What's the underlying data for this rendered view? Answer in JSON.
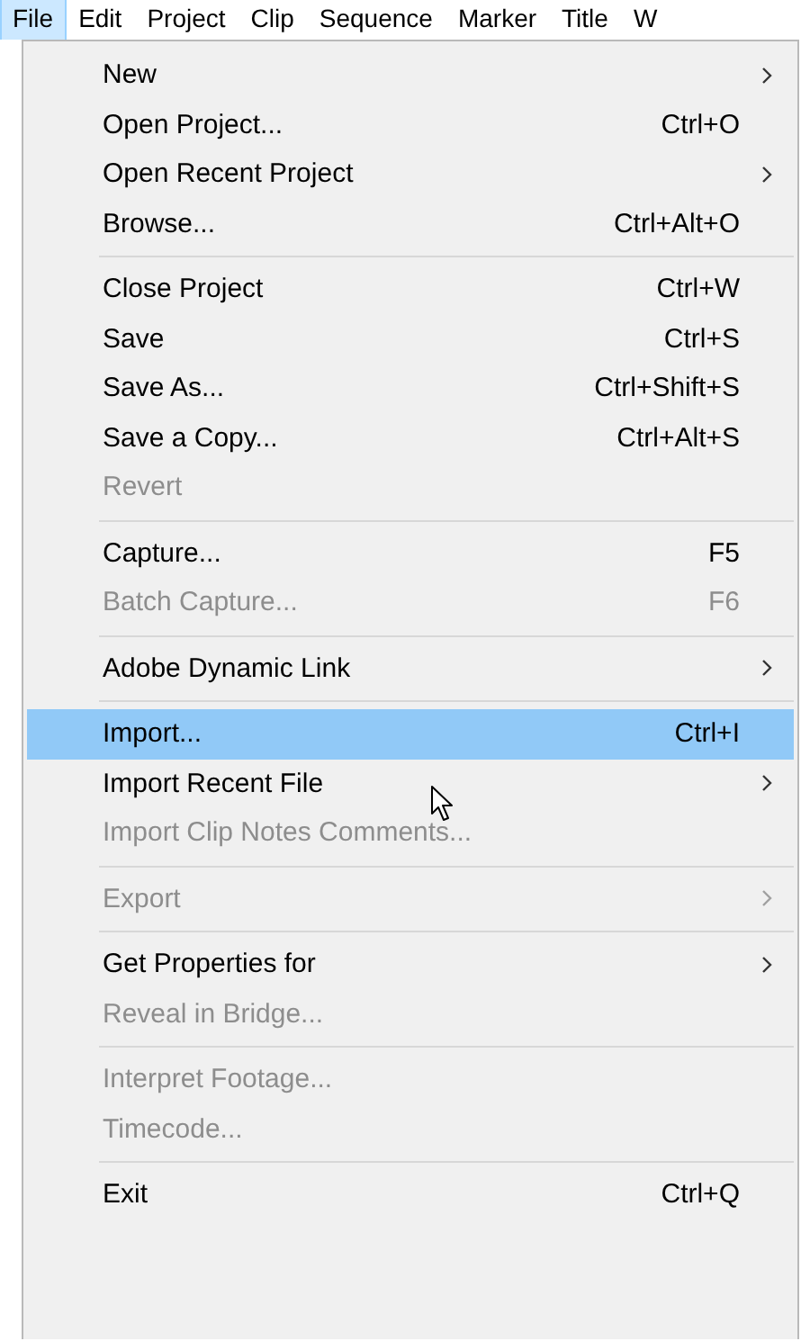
{
  "menubar": [
    {
      "label": "File",
      "selected": true
    },
    {
      "label": "Edit",
      "selected": false
    },
    {
      "label": "Project",
      "selected": false
    },
    {
      "label": "Clip",
      "selected": false
    },
    {
      "label": "Sequence",
      "selected": false
    },
    {
      "label": "Marker",
      "selected": false
    },
    {
      "label": "Title",
      "selected": false
    },
    {
      "label": "W",
      "selected": false
    }
  ],
  "menu": [
    {
      "kind": "item",
      "label": "New",
      "submenu": true,
      "disabled": false,
      "selected": false
    },
    {
      "kind": "item",
      "label": "Open Project...",
      "shortcut": "Ctrl+O",
      "disabled": false,
      "selected": false
    },
    {
      "kind": "item",
      "label": "Open Recent Project",
      "submenu": true,
      "disabled": false,
      "selected": false
    },
    {
      "kind": "item",
      "label": "Browse...",
      "shortcut": "Ctrl+Alt+O",
      "disabled": false,
      "selected": false
    },
    {
      "kind": "separator"
    },
    {
      "kind": "item",
      "label": "Close Project",
      "shortcut": "Ctrl+W",
      "disabled": false,
      "selected": false
    },
    {
      "kind": "item",
      "label": "Save",
      "shortcut": "Ctrl+S",
      "disabled": false,
      "selected": false
    },
    {
      "kind": "item",
      "label": "Save As...",
      "shortcut": "Ctrl+Shift+S",
      "disabled": false,
      "selected": false
    },
    {
      "kind": "item",
      "label": "Save a Copy...",
      "shortcut": "Ctrl+Alt+S",
      "disabled": false,
      "selected": false
    },
    {
      "kind": "item",
      "label": "Revert",
      "disabled": true,
      "selected": false
    },
    {
      "kind": "separator"
    },
    {
      "kind": "item",
      "label": "Capture...",
      "shortcut": "F5",
      "disabled": false,
      "selected": false
    },
    {
      "kind": "item",
      "label": "Batch Capture...",
      "shortcut": "F6",
      "disabled": true,
      "selected": false
    },
    {
      "kind": "separator"
    },
    {
      "kind": "item",
      "label": "Adobe Dynamic Link",
      "submenu": true,
      "disabled": false,
      "selected": false
    },
    {
      "kind": "separator"
    },
    {
      "kind": "item",
      "label": "Import...",
      "shortcut": "Ctrl+I",
      "disabled": false,
      "selected": true
    },
    {
      "kind": "item",
      "label": "Import Recent File",
      "submenu": true,
      "disabled": false,
      "selected": false
    },
    {
      "kind": "item",
      "label": "Import Clip Notes Comments...",
      "disabled": true,
      "selected": false
    },
    {
      "kind": "separator"
    },
    {
      "kind": "item",
      "label": "Export",
      "submenu": true,
      "disabled": true,
      "selected": false
    },
    {
      "kind": "separator"
    },
    {
      "kind": "item",
      "label": "Get Properties for",
      "submenu": true,
      "disabled": false,
      "selected": false
    },
    {
      "kind": "item",
      "label": "Reveal in Bridge...",
      "disabled": true,
      "selected": false
    },
    {
      "kind": "separator"
    },
    {
      "kind": "item",
      "label": "Interpret Footage...",
      "disabled": true,
      "selected": false
    },
    {
      "kind": "item",
      "label": "Timecode...",
      "disabled": true,
      "selected": false
    },
    {
      "kind": "separator"
    },
    {
      "kind": "item",
      "label": "Exit",
      "shortcut": "Ctrl+Q",
      "disabled": false,
      "selected": false
    }
  ]
}
